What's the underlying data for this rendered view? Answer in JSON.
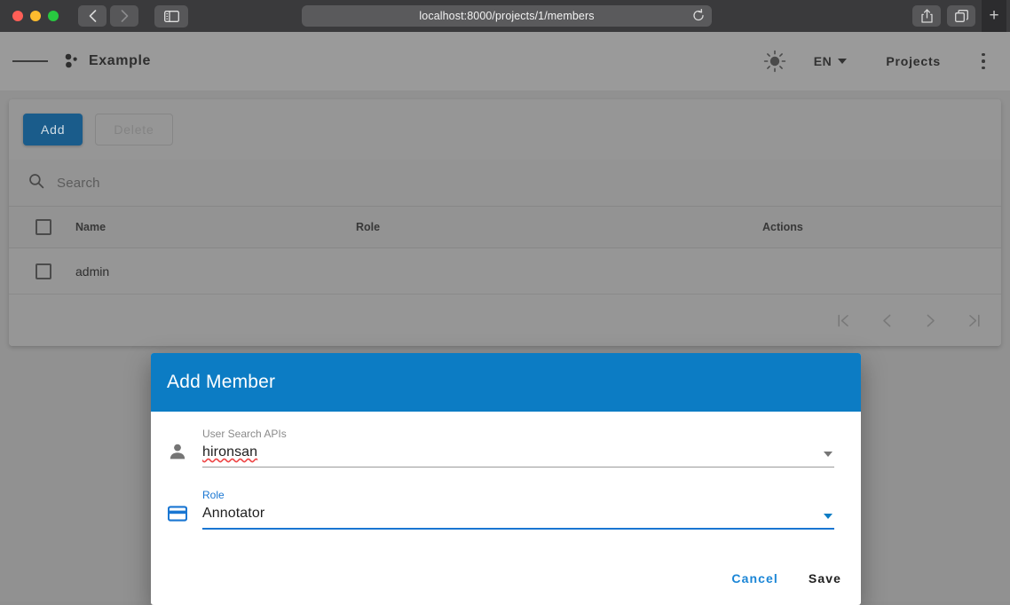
{
  "browser": {
    "url": "localhost:8000/projects/1/members",
    "back_icon": "chevron-left-icon",
    "forward_icon": "chevron-right-icon",
    "sidebar_icon": "sidebar-toggle-icon",
    "reload_icon": "reload-icon",
    "share_icon": "share-icon",
    "tabs_icon": "tab-overview-icon",
    "new_tab_label": "+"
  },
  "app_header": {
    "menu_icon": "hamburger-menu-icon",
    "logo_icon": "project-dots-icon",
    "title": "Example",
    "theme_icon": "sun-icon",
    "language": "EN",
    "projects_label": "Projects",
    "overflow_icon": "kebab-menu-icon"
  },
  "toolbar": {
    "add_label": "Add",
    "delete_label": "Delete"
  },
  "search": {
    "icon": "search-icon",
    "placeholder": "Search",
    "value": ""
  },
  "table": {
    "columns": [
      "Name",
      "Role",
      "Actions"
    ],
    "rows": [
      {
        "name": "admin",
        "role": "",
        "actions": ""
      }
    ]
  },
  "pagination": {
    "first_icon": "first-page-icon",
    "prev_icon": "previous-page-icon",
    "next_icon": "next-page-icon",
    "last_icon": "last-page-icon"
  },
  "modal": {
    "title": "Add Member",
    "fields": [
      {
        "icon": "person-icon",
        "label": "User Search APIs",
        "value": "hironsan",
        "caret": "chevron-down-icon"
      },
      {
        "icon": "card-icon",
        "label": "Role",
        "value": "Annotator",
        "caret": "chevron-down-icon"
      }
    ],
    "cancel_label": "Cancel",
    "save_label": "Save"
  },
  "colors": {
    "accent": "#0c7cc4",
    "add_button": "#1b5e8e",
    "link": "#1a85d6",
    "focus": "#1976d2",
    "spellcheck": "#ee4444"
  }
}
